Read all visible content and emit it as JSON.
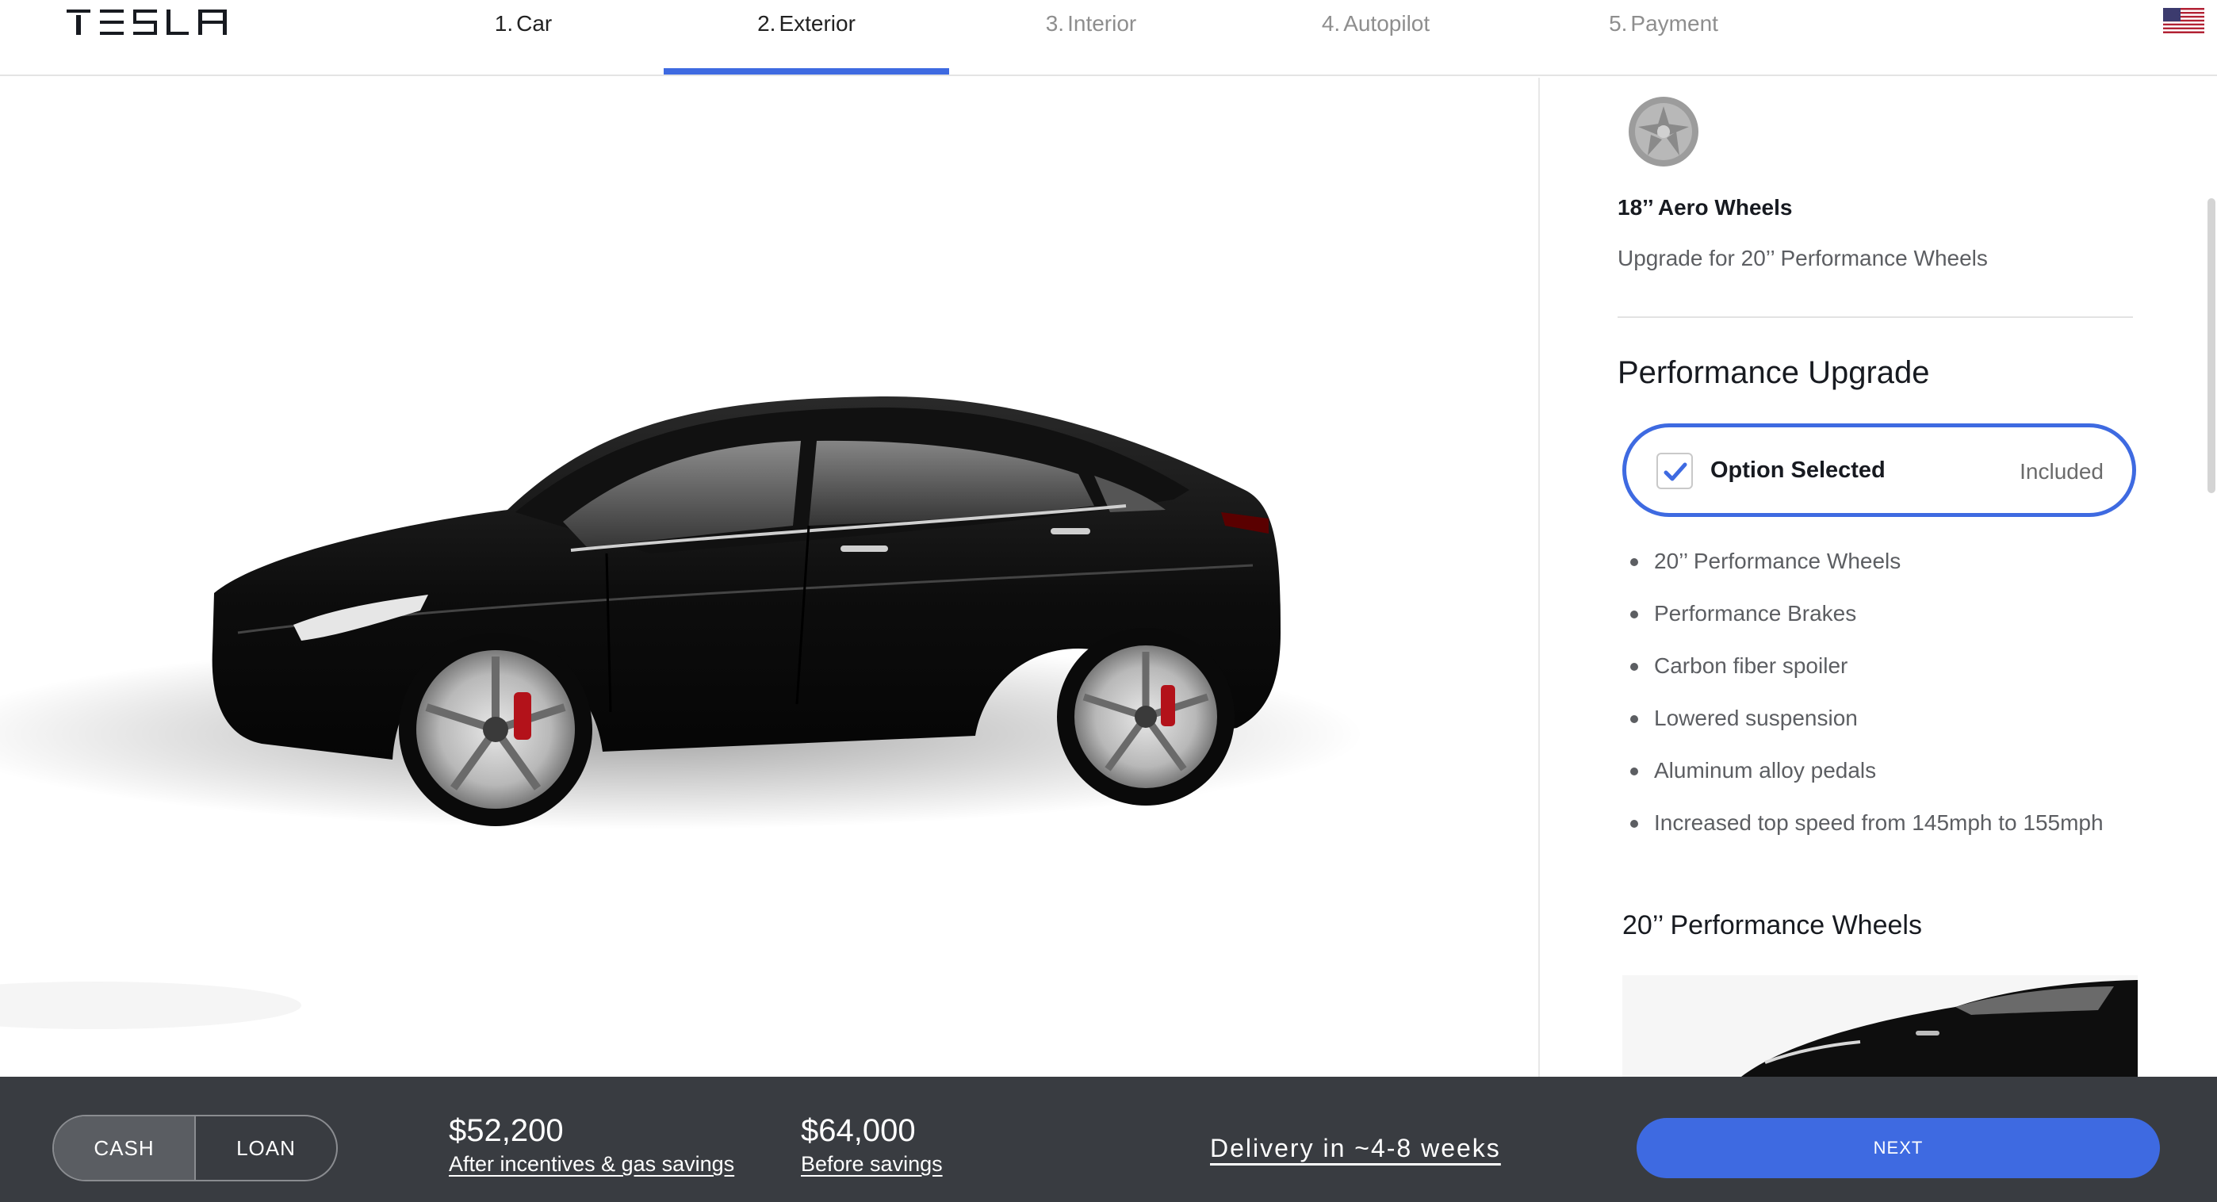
{
  "header": {
    "brand": "TESLA",
    "steps": [
      {
        "num": "1.",
        "label": "Car",
        "state": "done"
      },
      {
        "num": "2.",
        "label": "Exterior",
        "state": "active"
      },
      {
        "num": "3.",
        "label": "Interior",
        "state": "todo"
      },
      {
        "num": "4.",
        "label": "Autopilot",
        "state": "todo"
      },
      {
        "num": "5.",
        "label": "Payment",
        "state": "todo"
      }
    ],
    "region_icon": "us-flag-icon"
  },
  "panel": {
    "wheel_name": "18’’ Aero Wheels",
    "wheel_upgrade": "Upgrade for 20’’ Performance Wheels",
    "section_title": "Performance Upgrade",
    "option": {
      "label": "Option Selected",
      "price": "Included",
      "checked": true
    },
    "features": [
      "20’’ Performance Wheels",
      "Performance Brakes",
      "Carbon fiber spoiler",
      "Lowered suspension",
      "Aluminum alloy pedals",
      "Increased top speed from 145mph to 155mph"
    ],
    "sub_title": "20’’ Performance Wheels"
  },
  "footer": {
    "payment_tabs": [
      "CASH",
      "LOAN"
    ],
    "active_payment": "CASH",
    "price_after": "$52,200",
    "price_after_note": "After incentives & gas savings",
    "price_before": "$64,000",
    "price_before_note": "Before savings",
    "delivery": "Delivery in ~4-8 weeks",
    "next_label": "NEXT"
  },
  "colors": {
    "accent": "#3e6ae1",
    "footer_bg": "#393c41",
    "car_paint": "#111111"
  }
}
